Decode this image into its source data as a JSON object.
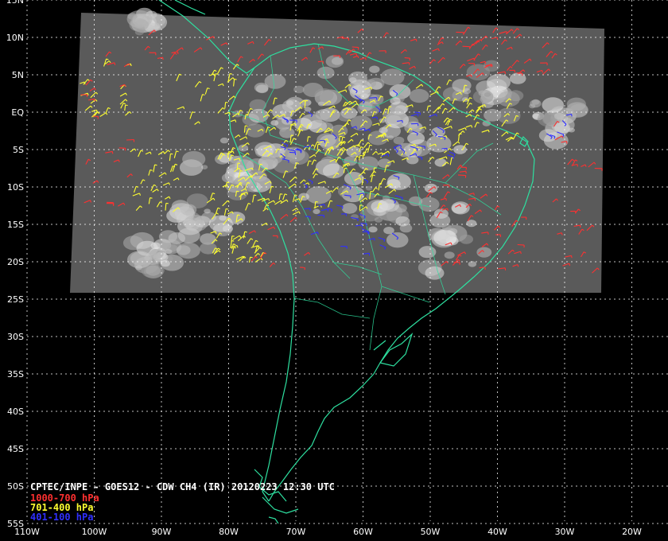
{
  "caption": {
    "title": "CPTEC/INPE - GOES12 - CDW CH4 (IR) 20120223 12:30 UTC",
    "legend": [
      {
        "label": "1000-700 hPa",
        "color": "#ff3030"
      },
      {
        "label": "701-400 hPa",
        "color": "#ffff30"
      },
      {
        "label": "401-100 hPa",
        "color": "#3030ff"
      }
    ]
  },
  "grid": {
    "lat_labels": [
      "15N",
      "10N",
      "5N",
      "EQ",
      "5S",
      "10S",
      "15S",
      "20S",
      "25S",
      "30S",
      "35S",
      "40S",
      "45S",
      "50S",
      "55S"
    ],
    "lon_labels": [
      "110W",
      "100W",
      "90W",
      "80W",
      "70W",
      "60W",
      "50W",
      "40W",
      "30W",
      "20W"
    ],
    "line_color": "#ffffff",
    "coast_color": "#2ee0a0"
  },
  "imagery": {
    "tone": "grayscale-ir"
  }
}
